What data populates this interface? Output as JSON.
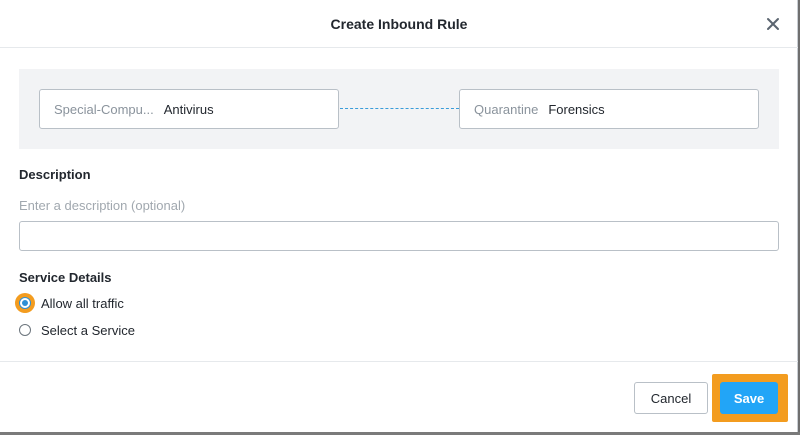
{
  "modal": {
    "title": "Create Inbound Rule",
    "close_icon": "close-icon"
  },
  "rule": {
    "source": {
      "label": "Special-Compu...",
      "value": "Antivirus"
    },
    "target": {
      "label": "Quarantine",
      "value": "Forensics"
    }
  },
  "description": {
    "title": "Description",
    "hint": "Enter a description (optional)",
    "value": ""
  },
  "service_details": {
    "title": "Service Details",
    "options": [
      {
        "label": "Allow all traffic",
        "selected": true
      },
      {
        "label": "Select a Service",
        "selected": false
      }
    ]
  },
  "footer": {
    "cancel_label": "Cancel",
    "save_label": "Save"
  },
  "colors": {
    "accent": "#22a5f7",
    "highlight": "#f39c1f",
    "connector": "#3a9cd9"
  }
}
